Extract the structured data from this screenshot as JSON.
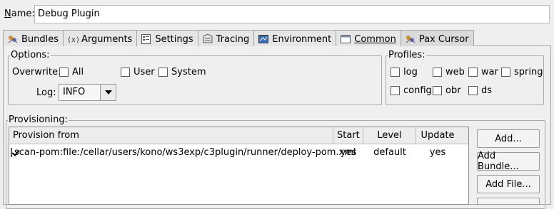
{
  "name_row": {
    "label": "Name:",
    "value": "Debug Plugin"
  },
  "tabs": [
    {
      "label": "Bundles",
      "icon": "bundles-icon",
      "active": false
    },
    {
      "label": "Arguments",
      "icon": "arguments-icon",
      "active": false
    },
    {
      "label": "Settings",
      "icon": "settings-icon",
      "active": false
    },
    {
      "label": "Tracing",
      "icon": "tracing-icon",
      "active": false
    },
    {
      "label": "Environment",
      "icon": "environment-icon",
      "active": false
    },
    {
      "label": "Common",
      "icon": "common-icon",
      "active": false
    },
    {
      "label": "Pax Cursor",
      "icon": "pax-cursor-icon",
      "active": true
    }
  ],
  "options": {
    "title": "Options:",
    "overwrite_label": "Overwrite:",
    "checkboxes": [
      {
        "label": "All",
        "checked": false
      },
      {
        "label": "User",
        "checked": false
      },
      {
        "label": "System",
        "checked": false
      }
    ],
    "log_label": "Log:",
    "log_value": "INFO"
  },
  "profiles": {
    "title": "Profiles:",
    "row1": [
      {
        "label": "log",
        "checked": false
      },
      {
        "label": "web",
        "checked": false
      },
      {
        "label": "war",
        "checked": false
      },
      {
        "label": "spring",
        "checked": false
      }
    ],
    "row2": [
      {
        "label": "config",
        "checked": false
      },
      {
        "label": "obr",
        "checked": false
      },
      {
        "label": "ds",
        "checked": false
      }
    ]
  },
  "provisioning": {
    "title": "Provisioning:",
    "columns": [
      "Provision from",
      "Start",
      "Level",
      "Update"
    ],
    "rows": [
      {
        "checked": true,
        "from": "scan-pom:file:/cellar/users/kono/ws3exp/c3plugin/runner/deploy-pom.xml",
        "start": "yes",
        "level": "default",
        "update": "yes"
      }
    ],
    "buttons": [
      "Add...",
      "Add Bundle...",
      "Add File..."
    ]
  },
  "colors": {
    "background": "#efefef",
    "tab_active": "#dadada"
  }
}
